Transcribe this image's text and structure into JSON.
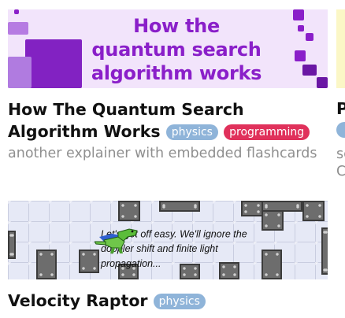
{
  "cards": [
    {
      "thumbnail_text": "How the\nquantum search\nalgorithm works",
      "title": "How The Quantum Search Algorithm Works",
      "tags": [
        "physics",
        "programming"
      ],
      "description": "another explainer with embedded flashcards"
    },
    {
      "title": "P",
      "description": "sc\nC"
    },
    {
      "thumbnail_text": "Let's get off easy. We'll ignore the\ndoppler shift and finite light propagation...",
      "title": "Velocity Raptor",
      "tags": [
        "physics"
      ]
    }
  ],
  "colors": {
    "tag_physics": "#8fb4d9",
    "tag_programming": "#e0315b",
    "thumbnail_purple": "#8a1fc9",
    "thumbnail_lavender": "#f2e4fb",
    "description_gray": "#8f8f8f"
  },
  "icons": [
    "dinosaur-raptor-sprite"
  ]
}
